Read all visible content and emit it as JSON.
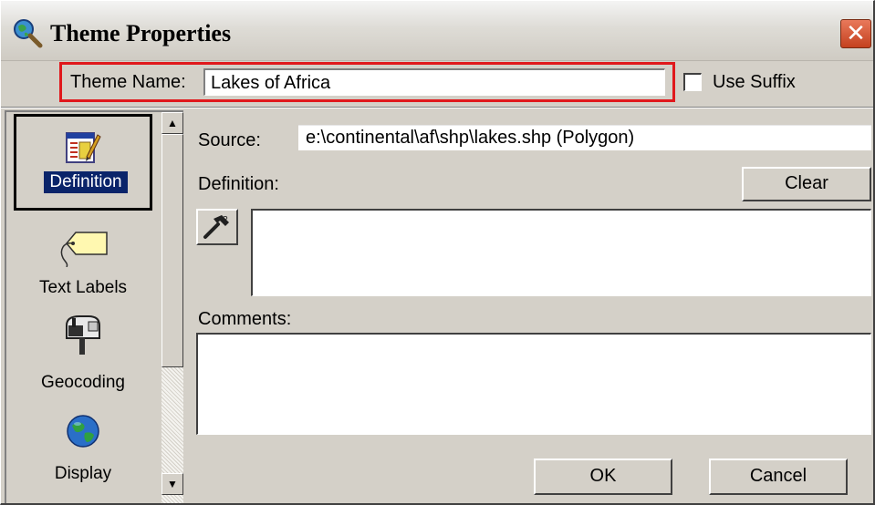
{
  "window": {
    "title": "Theme Properties",
    "close_glyph": "✕",
    "icon": "search-globe-icon"
  },
  "theme_name": {
    "label": "Theme Name:",
    "value": "Lakes of Africa",
    "highlight_color": "#e0181c"
  },
  "use_suffix": {
    "label": "Use Suffix",
    "checked": false
  },
  "sidebar": {
    "items": [
      {
        "label": "Definition",
        "icon": "definition-icon",
        "selected": true
      },
      {
        "label": "Text Labels",
        "icon": "tag-label-icon",
        "selected": false
      },
      {
        "label": "Geocoding",
        "icon": "mailbox-icon",
        "selected": false
      },
      {
        "label": "Display",
        "icon": "globe-icon",
        "selected": false
      }
    ],
    "scroll_up": "▲",
    "scroll_down": "▼"
  },
  "source": {
    "label": "Source:",
    "value": "e:\\continental\\af\\shp\\lakes.shp (Polygon)"
  },
  "definition": {
    "label": "Definition:",
    "clear_label": "Clear",
    "query_builder_icon": "hammer-icon",
    "value": ""
  },
  "comments": {
    "label": "Comments:",
    "value": ""
  },
  "footer": {
    "ok_label": "OK",
    "cancel_label": "Cancel"
  }
}
